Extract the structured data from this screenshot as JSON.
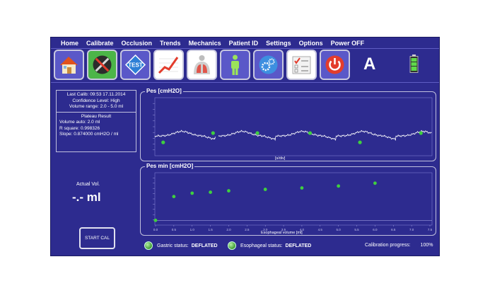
{
  "menu": [
    "Home",
    "Calibrate",
    "Occlusion",
    "Trends",
    "Mechanics",
    "Patient ID",
    "Settings",
    "Options",
    "Power OFF"
  ],
  "toolbar": {
    "icons": [
      "home-icon",
      "tools-icon",
      "test-icon",
      "trend-chart-icon",
      "lungs-icon",
      "patient-icon",
      "settings-gears-icon",
      "checklist-icon",
      "power-icon"
    ],
    "mode_letter": "A",
    "battery_icon": "battery-full-icon"
  },
  "info": {
    "last_calib": "Last Calib:  09:53  17.11.2014",
    "confidence": "Confidence Level:  High",
    "volume_range": "Volume range:  2.0 - 5.0 ml",
    "plateau_title": "Plateau Result",
    "volume_auto": "Volume auto:   2.0 ml",
    "r_square": "R square:  0.998326",
    "slope": "Slope:  0.874000       cmH2O / ml"
  },
  "actual": {
    "label": "Actual Vol.",
    "value": "-.- ml"
  },
  "start_cal_label": "START CAL",
  "pes_chart": {
    "title": "Pes [cmH2O]",
    "xlabel": "[s/div]",
    "markers": [
      [
        0.03,
        0.77
      ],
      [
        0.21,
        0.61
      ],
      [
        0.37,
        0.61
      ],
      [
        0.56,
        0.61
      ],
      [
        0.74,
        0.77
      ],
      [
        0.96,
        0.61
      ]
    ]
  },
  "pesmin_chart": {
    "title": "Pes min [cmH2O]",
    "xlabel": "Esophageal volume [ml]",
    "x_ticks": [
      "0.0",
      "0.5",
      "1.0",
      "1.5",
      "2.0",
      "2.5",
      "3.0",
      "3.5",
      "4.0",
      "4.5",
      "5.0",
      "5.5",
      "6.0",
      "6.5",
      "7.0",
      "7.5"
    ],
    "points": [
      [
        0.0,
        1.0
      ],
      [
        0.5,
        6.0
      ],
      [
        1.0,
        6.7
      ],
      [
        1.5,
        6.9
      ],
      [
        2.0,
        7.2
      ],
      [
        3.0,
        7.5
      ],
      [
        4.0,
        7.8
      ],
      [
        5.0,
        8.2
      ],
      [
        6.0,
        8.8
      ]
    ]
  },
  "status": {
    "gastric_label": "Gastric status:",
    "gastric_value": "DEFLATED",
    "esophageal_label": "Esophageal status:",
    "esophageal_value": "DEFLATED",
    "progress_label": "Calibration progress:",
    "progress_value": "100%"
  },
  "colors": {
    "background": "#2d2b8f",
    "marker": "#3fcf3f",
    "trace": "#ffffff"
  }
}
